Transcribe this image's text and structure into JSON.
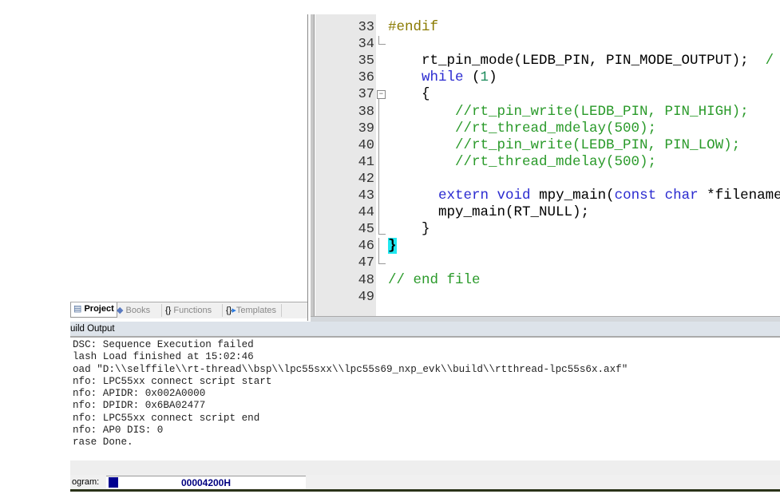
{
  "editor": {
    "lines": [
      {
        "n": "33",
        "tokens": [
          {
            "t": "#endif",
            "k": "pre"
          }
        ]
      },
      {
        "n": "34",
        "tokens": []
      },
      {
        "n": "35",
        "tokens": [
          {
            "t": "    rt_pin_mode(LEDB_PIN, PIN_MODE_OUTPUT);  ",
            "k": "n"
          },
          {
            "t": "/",
            "k": "cm"
          }
        ]
      },
      {
        "n": "36",
        "tokens": [
          {
            "t": "    ",
            "k": "n"
          },
          {
            "t": "while",
            "k": "kw"
          },
          {
            "t": " (",
            "k": "n"
          },
          {
            "t": "1",
            "k": "num"
          },
          {
            "t": ")",
            "k": "n"
          }
        ]
      },
      {
        "n": "37",
        "tokens": [
          {
            "t": "    {",
            "k": "n"
          }
        ]
      },
      {
        "n": "38",
        "tokens": [
          {
            "t": "        //rt_pin_write(LEDB_PIN, PIN_HIGH);",
            "k": "cm"
          }
        ]
      },
      {
        "n": "39",
        "tokens": [
          {
            "t": "        //rt_thread_mdelay(500);",
            "k": "cm"
          }
        ]
      },
      {
        "n": "40",
        "tokens": [
          {
            "t": "        //rt_pin_write(LEDB_PIN, PIN_LOW);",
            "k": "cm"
          }
        ]
      },
      {
        "n": "41",
        "tokens": [
          {
            "t": "        //rt_thread_mdelay(500);",
            "k": "cm"
          }
        ]
      },
      {
        "n": "42",
        "tokens": []
      },
      {
        "n": "43",
        "tokens": [
          {
            "t": "      ",
            "k": "n"
          },
          {
            "t": "extern",
            "k": "kw"
          },
          {
            "t": " ",
            "k": "n"
          },
          {
            "t": "void",
            "k": "kw"
          },
          {
            "t": " mpy_main(",
            "k": "n"
          },
          {
            "t": "const",
            "k": "kw"
          },
          {
            "t": " ",
            "k": "n"
          },
          {
            "t": "char",
            "k": "kw"
          },
          {
            "t": " *filename",
            "k": "n"
          }
        ]
      },
      {
        "n": "44",
        "tokens": [
          {
            "t": "      mpy_main(RT_NULL);",
            "k": "n"
          }
        ]
      },
      {
        "n": "45",
        "tokens": [
          {
            "t": "    }",
            "k": "n"
          }
        ]
      },
      {
        "n": "46",
        "tokens": [
          {
            "t": "}",
            "k": "hl"
          }
        ]
      },
      {
        "n": "47",
        "tokens": []
      },
      {
        "n": "48",
        "tokens": [
          {
            "t": "// end file",
            "k": "cm"
          }
        ]
      },
      {
        "n": "49",
        "tokens": []
      }
    ]
  },
  "tabs": [
    {
      "label": "Project",
      "icon": "project-icon",
      "active": true
    },
    {
      "label": "Books",
      "icon": "books-icon"
    },
    {
      "label": "Functions",
      "icon": "functions-icon"
    },
    {
      "label": "Templates",
      "icon": "templates-icon"
    }
  ],
  "output": {
    "title": "uild Output",
    "lines": [
      "DSC: Sequence Execution failed",
      "lash Load finished at 15:02:46",
      "oad \"D:\\\\selffile\\\\rt-thread\\\\bsp\\\\lpc55sxx\\\\lpc55s69_nxp_evk\\\\build\\\\rtthread-lpc55s6x.axf\"",
      "nfo: LPC55xx connect script start",
      "nfo: APIDR: 0x002A0000",
      "nfo: DPIDR: 0x6BA02477",
      "nfo: LPC55xx connect script end",
      "nfo: AP0 DIS: 0",
      "rase Done."
    ]
  },
  "status": {
    "label": "ogram:",
    "progress_value": "00004200H",
    "progress_fraction": 0.05,
    "progress_color": "#000090"
  }
}
